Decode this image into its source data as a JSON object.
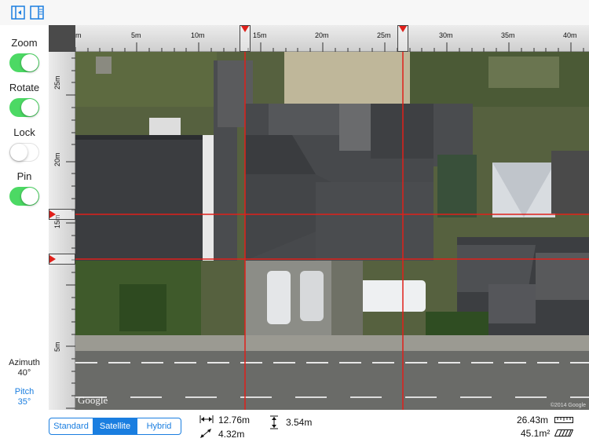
{
  "toolbar": {
    "icons": [
      "collapse-panel-icon",
      "split-view-icon"
    ],
    "accent": "#1a7ee0"
  },
  "toggles": [
    {
      "label": "Zoom",
      "on": true
    },
    {
      "label": "Rotate",
      "on": true
    },
    {
      "label": "Lock",
      "on": false
    },
    {
      "label": "Pin",
      "on": true
    }
  ],
  "azimuth": {
    "label": "Azimuth",
    "value": "40°"
  },
  "pitch": {
    "label": "Pitch",
    "value": "35°"
  },
  "ruler": {
    "top_ticks": [
      "m",
      "5m",
      "10m",
      "15m",
      "20m",
      "25m",
      "30m",
      "35m",
      "40m"
    ],
    "left_ticks": [
      "25m",
      "20m",
      "15m",
      "5m"
    ]
  },
  "map": {
    "google_logo": "Google",
    "copyright": "©2014 Google"
  },
  "map_types": {
    "options": [
      "Standard",
      "Satellite",
      "Hybrid"
    ],
    "selected": "Satellite"
  },
  "measurements": {
    "width": "12.76m",
    "diagonal": "4.32m",
    "height": "3.54m",
    "perimeter": "26.43m",
    "area": "45.1m²"
  },
  "colors": {
    "toggle_on": "#4cd964",
    "guide_line": "#e0201a"
  }
}
